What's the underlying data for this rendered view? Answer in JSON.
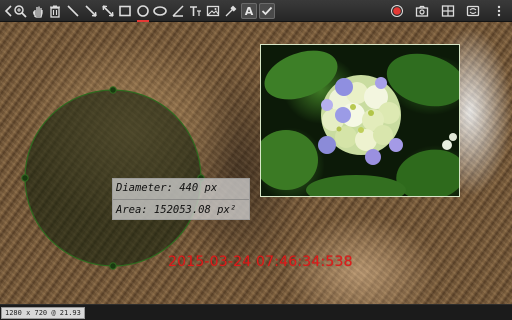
{
  "toolbar": {
    "left_tools": [
      {
        "name": "back-icon"
      },
      {
        "name": "zoom-icon"
      },
      {
        "name": "pan-hand-icon"
      },
      {
        "name": "delete-icon"
      },
      {
        "name": "line-tool-icon"
      },
      {
        "name": "arrow-line-tool-icon"
      },
      {
        "name": "double-arrow-line-tool-icon"
      },
      {
        "name": "rectangle-tool-icon"
      },
      {
        "name": "circle-tool-icon",
        "active": true
      },
      {
        "name": "ellipse-tool-icon"
      },
      {
        "name": "angle-tool-icon"
      },
      {
        "name": "text-tool-icon"
      },
      {
        "name": "image-icon"
      },
      {
        "name": "color-picker-icon"
      },
      {
        "name": "font-icon",
        "label": "A"
      },
      {
        "name": "confirm-check-icon"
      }
    ],
    "right_tools": [
      {
        "name": "record-icon"
      },
      {
        "name": "camera-snapshot-icon"
      },
      {
        "name": "grid-layout-icon"
      },
      {
        "name": "camera-switch-icon"
      },
      {
        "name": "more-options-icon"
      }
    ],
    "colors": {
      "record": "#e53935",
      "active_indicator": "#e53935"
    }
  },
  "measurement": {
    "diameter_label": "Diameter: 440 px",
    "area_label": "Area: 152053.08 px²",
    "circle_color": "#2f6a1f"
  },
  "overlay": {
    "timestamp": "2015-03-24 07:46:34:538",
    "timestamp_color": "#e21a1a"
  },
  "status": {
    "resolution": "1280 x 720 @ 21.93"
  }
}
